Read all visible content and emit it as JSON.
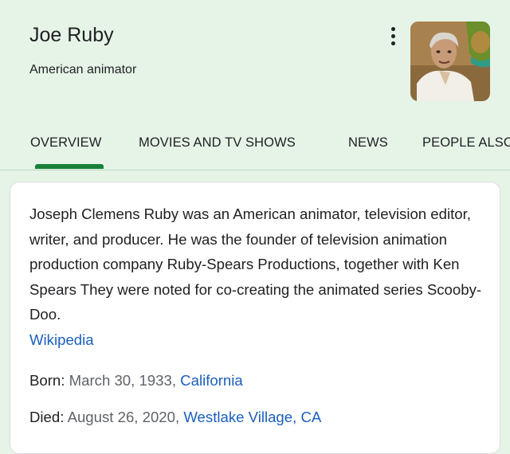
{
  "header": {
    "title": "Joe Ruby",
    "subtitle": "American animator"
  },
  "tabs": [
    {
      "label": "OVERVIEW",
      "selected": true
    },
    {
      "label": "MOVIES AND TV SHOWS",
      "selected": false
    },
    {
      "label": "NEWS",
      "selected": false
    },
    {
      "label": "PEOPLE ALSO SEARCH FOR",
      "selected": false
    }
  ],
  "card": {
    "description": "Joseph Clemens Ruby was an American animator, television editor, writer, and producer. He was the founder of television animation production company Ruby-Spears Productions, together with Ken Spears They were noted for co-creating the animated series Scooby-Doo.",
    "source_link": "Wikipedia",
    "born": {
      "label": "Born:",
      "date": "March 30, 1933",
      "sep": ",",
      "place": "California"
    },
    "died": {
      "label": "Died:",
      "date": "August 26, 2020",
      "sep": ",",
      "place": "Westlake Village, CA"
    }
  },
  "colors": {
    "header_bg": "#e6f4e8",
    "tab_indicator": "#188038",
    "link": "#1a5fbf",
    "muted": "#5f6368"
  },
  "icons": {
    "more": "more-vert-icon"
  }
}
